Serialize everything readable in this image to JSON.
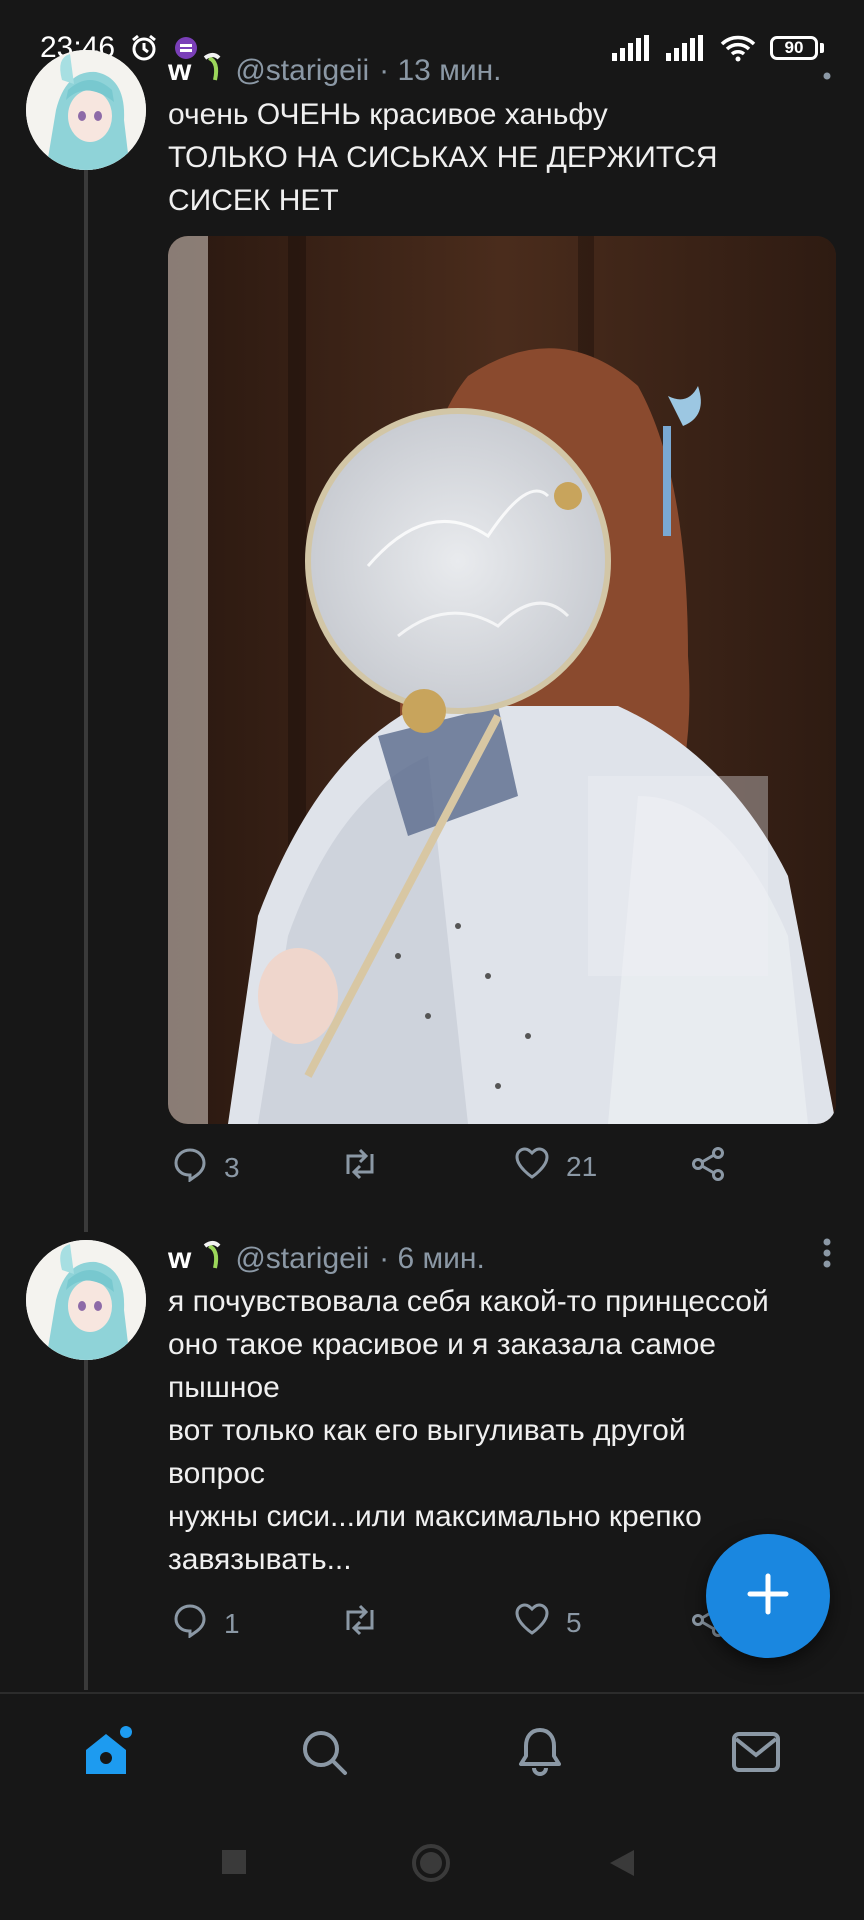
{
  "status_bar": {
    "time": "23:46",
    "battery": "90"
  },
  "tweet1": {
    "name": "w",
    "handle": "@starigeii",
    "time": "· 13 мин.",
    "lines": [
      "очень ОЧЕНЬ красивое ханьфу",
      "ТОЛЬКО НА СИСЬКАХ НЕ ДЕРЖИТСЯ",
      "СИСЕК НЕТ"
    ],
    "replies": "3",
    "likes": "21"
  },
  "tweet2": {
    "name": "w",
    "handle": "@starigeii",
    "time": "· 6 мин.",
    "lines": [
      "я почувствовала себя какой-то принцессой",
      "оно такое красивое и я заказала самое",
      "пышное",
      "вот только как его выгуливать другой",
      "вопрос",
      "нужны сиси...или максимально крепко",
      "завязывать..."
    ],
    "replies": "1",
    "likes": "5"
  },
  "colors": {
    "accent": "#1a87e0",
    "muted": "#8b98a5",
    "background": "#171717"
  },
  "icons": [
    "alarm-icon",
    "app-badge-icon",
    "signal-icon",
    "wifi-icon",
    "battery-icon",
    "more-icon",
    "reply-icon",
    "retweet-icon",
    "like-icon",
    "share-icon",
    "compose-icon",
    "home-icon",
    "search-icon",
    "notifications-icon",
    "messages-icon"
  ]
}
